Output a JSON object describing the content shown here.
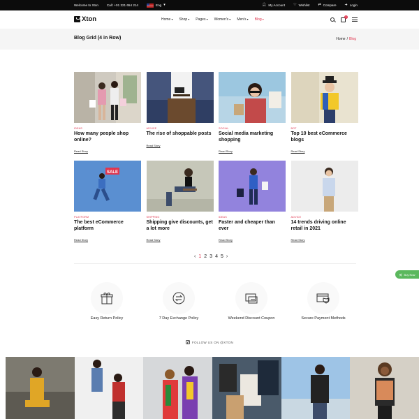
{
  "topbar": {
    "welcome": "Welcome to Xton",
    "call": "Call: +01 321 654 214",
    "language": "Eng",
    "my_account": "My Account",
    "wishlist": "Wishlist",
    "compare": "Compare",
    "login": "Login"
  },
  "header": {
    "logo": "Xton",
    "nav": [
      {
        "label": "Home",
        "active": false
      },
      {
        "label": "Shop",
        "active": false
      },
      {
        "label": "Pages",
        "active": false
      },
      {
        "label": "Women's",
        "active": false
      },
      {
        "label": "Men's",
        "active": false
      },
      {
        "label": "Blog",
        "active": true
      }
    ],
    "cart_count": "1"
  },
  "page": {
    "title": "Blog Grid (4 in Row)",
    "breadcrumb": [
      "Home",
      "Blog"
    ],
    "breadcrumb_sep": "/"
  },
  "posts": [
    {
      "category": "IDEAS",
      "title": "How many people shop online?",
      "read_more": "Read Story"
    },
    {
      "category": "ADVICE",
      "title": "The rise of shoppable posts",
      "read_more": "Read Story"
    },
    {
      "category": "SOCIAL",
      "title": "Social media marketing shopping",
      "read_more": "Read Story"
    },
    {
      "category": "BOT",
      "title": "Top 10 best eCommerce blogs",
      "read_more": "Read Story"
    },
    {
      "category": "PLATFORM",
      "title": "The best eCommerce platform",
      "read_more": "Read Story"
    },
    {
      "category": "SHIPPING",
      "title": "Shipping give discounts, get a lot more",
      "read_more": "Read Story"
    },
    {
      "category": "IDEAS",
      "title": "Faster and cheaper than ever",
      "read_more": "Read Story"
    },
    {
      "category": "ADVICE",
      "title": "14 trends driving online retail in 2021",
      "read_more": "Read Story"
    }
  ],
  "pagination": {
    "prev": "‹",
    "pages": [
      "1",
      "2",
      "3",
      "4",
      "5"
    ],
    "current": "1",
    "next": "›"
  },
  "buy_now": "Buy Now",
  "features": [
    {
      "label": "Easy Return Policy",
      "icon": "gift-box-icon"
    },
    {
      "label": "7 Day Exchange Policy",
      "icon": "exchange-icon"
    },
    {
      "label": "Weekend Discount Coupon",
      "icon": "coupon-icon"
    },
    {
      "label": "Secure Payment Methods",
      "icon": "secure-card-icon"
    }
  ],
  "instagram": {
    "heading": "FOLLOW US ON @XTON"
  },
  "colors": {
    "accent": "#e0364f",
    "topbar": "#0c0c0c",
    "buy_now": "#5bb85d"
  }
}
